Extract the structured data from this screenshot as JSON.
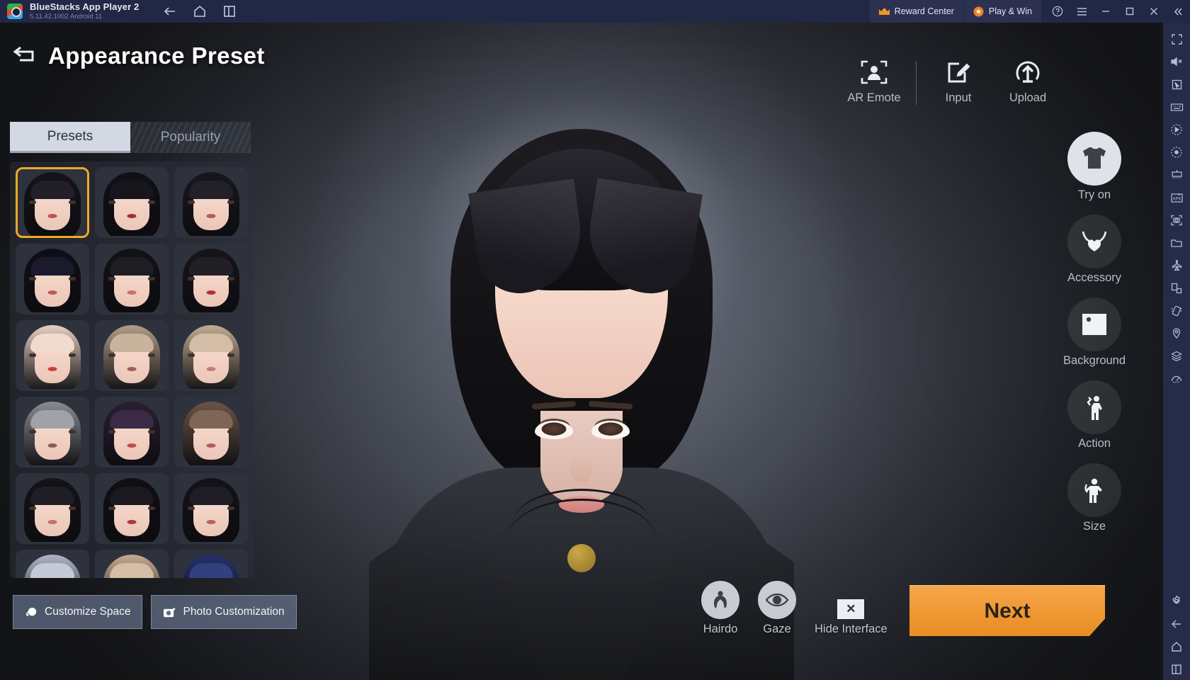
{
  "bluestacks": {
    "app_name": "BlueStacks App Player 2",
    "version_line": "5.11.42.1002  Android 11",
    "nav": [
      {
        "name": "back-icon",
        "label": "Back"
      },
      {
        "name": "home-icon",
        "label": "Home"
      },
      {
        "name": "multi-instance-icon",
        "label": "Multi-instance"
      }
    ],
    "reward_center": "Reward Center",
    "play_and_win": "Play & Win",
    "window_buttons": [
      {
        "name": "help-icon",
        "label": "Help"
      },
      {
        "name": "menu-icon",
        "label": "Menu"
      },
      {
        "name": "minimize-icon",
        "label": "Minimize"
      },
      {
        "name": "maximize-icon",
        "label": "Maximize"
      },
      {
        "name": "close-icon",
        "label": "Close"
      },
      {
        "name": "collapse-sidebar-icon",
        "label": "Collapse"
      }
    ],
    "sidebar_icons": [
      {
        "name": "fullscreen-icon",
        "label": "Full screen"
      },
      {
        "name": "mute-icon",
        "label": "Mute"
      },
      {
        "name": "cursor-icon",
        "label": "Game controls"
      },
      {
        "name": "keyboard-icon",
        "label": "Keymapping"
      },
      {
        "name": "macro-record-icon",
        "label": "Macro recorder"
      },
      {
        "name": "script-icon",
        "label": "Script"
      },
      {
        "name": "multi-instance-manager-icon",
        "label": "Multi-instance manager"
      },
      {
        "name": "install-apk-icon",
        "label": "Install APK"
      },
      {
        "name": "screenshot-icon",
        "label": "Screenshot"
      },
      {
        "name": "media-manager-icon",
        "label": "Media manager"
      },
      {
        "name": "airplane-icon",
        "label": "Airplane mode"
      },
      {
        "name": "rotate-screen-icon",
        "label": "Rotate"
      },
      {
        "name": "shake-icon",
        "label": "Shake"
      },
      {
        "name": "location-icon",
        "label": "Location"
      },
      {
        "name": "layers-icon",
        "label": "Eco mode"
      },
      {
        "name": "performance-icon",
        "label": "Performance"
      },
      {
        "name": "settings-gear-icon",
        "label": "Settings"
      },
      {
        "name": "android-back-icon",
        "label": "Back"
      },
      {
        "name": "android-home-icon",
        "label": "Home"
      },
      {
        "name": "android-recents-icon",
        "label": "Recents"
      }
    ]
  },
  "game": {
    "header": {
      "back_icon": "back-arrow-icon",
      "title": "Appearance Preset"
    },
    "tabs": [
      {
        "label": "Presets",
        "active": true
      },
      {
        "label": "Popularity",
        "active": false
      }
    ],
    "presets": [
      {
        "id": 1,
        "selected": true,
        "hair": "#14131a",
        "bang": "#221f28",
        "lip": "#c2544f",
        "label": "Preset 1"
      },
      {
        "id": 2,
        "selected": false,
        "hair": "#111016",
        "bang": "#17161d",
        "lip": "#9e2f36",
        "label": "Preset 2"
      },
      {
        "id": 3,
        "selected": false,
        "hair": "#18171d",
        "bang": "#232128",
        "lip": "#b85a55",
        "label": "Preset 3"
      },
      {
        "id": 4,
        "selected": false,
        "hair": "#0f0e18",
        "bang": "#1b1a2c",
        "lip": "#c45b56",
        "label": "Preset 4"
      },
      {
        "id": 5,
        "selected": false,
        "hair": "#131217",
        "bang": "#1f1d24",
        "lip": "#c9716b",
        "label": "Preset 5"
      },
      {
        "id": 6,
        "selected": false,
        "hair": "#16151a",
        "bang": "#222026",
        "lip": "#b42f33",
        "label": "Preset 6"
      },
      {
        "id": 7,
        "selected": false,
        "hair": "#e8cfc2",
        "bang": "#f0dbcf",
        "lip": "#d33c3c",
        "label": "Preset 7"
      },
      {
        "id": 8,
        "selected": false,
        "hair": "#b39d86",
        "bang": "#c8b49d",
        "lip": "#9c5d56",
        "label": "Preset 8"
      },
      {
        "id": 9,
        "selected": false,
        "hair": "#c2ab93",
        "bang": "#d3bda6",
        "lip": "#c08078",
        "label": "Preset 9"
      },
      {
        "id": 10,
        "selected": false,
        "hair": "#8a8c92",
        "bang": "#a0a2a8",
        "lip": "#8e5b55",
        "label": "Preset 10"
      },
      {
        "id": 11,
        "selected": false,
        "hair": "#2a1f33",
        "bang": "#3a2c45",
        "lip": "#b8504c",
        "label": "Preset 11"
      },
      {
        "id": 12,
        "selected": false,
        "hair": "#6b5446",
        "bang": "#7e6555",
        "lip": "#b05a59",
        "label": "Preset 12"
      },
      {
        "id": 13,
        "selected": false,
        "hair": "#141318",
        "bang": "#201e25",
        "lip": "#c4716c",
        "label": "Preset 13"
      },
      {
        "id": 14,
        "selected": false,
        "hair": "#100f14",
        "bang": "#1b191f",
        "lip": "#a83b3c",
        "label": "Preset 14"
      },
      {
        "id": 15,
        "selected": false,
        "hair": "#131219",
        "bang": "#1e1c25",
        "lip": "#b9615c",
        "label": "Preset 15"
      },
      {
        "id": 16,
        "selected": false,
        "hair": "#aeb4c4",
        "bang": "#c3c9d6",
        "lip": "#b06a66",
        "label": "Preset 16"
      },
      {
        "id": 17,
        "selected": false,
        "hair": "#c4a98f",
        "bang": "#d6bda4",
        "lip": "#b46a63",
        "label": "Preset 17"
      },
      {
        "id": 18,
        "selected": false,
        "hair": "#24306b",
        "bang": "#32407f",
        "lip": "#b4565a",
        "label": "Preset 18"
      }
    ],
    "bottom_left_buttons": [
      {
        "icon": "customize-space-icon",
        "label": "Customize Space"
      },
      {
        "icon": "photo-camera-icon",
        "label": "Photo Customization"
      }
    ],
    "top_right_tools": [
      {
        "icon": "ar-emote-icon",
        "label": "AR Emote"
      },
      {
        "icon": "input-edit-icon",
        "label": "Input"
      },
      {
        "icon": "upload-icon",
        "label": "Upload"
      }
    ],
    "right_menu": [
      {
        "icon": "tshirt-icon",
        "label": "Try on",
        "style": "light"
      },
      {
        "icon": "necklace-icon",
        "label": "Accessory",
        "style": "dark"
      },
      {
        "icon": "image-icon",
        "label": "Background",
        "style": "dark"
      },
      {
        "icon": "action-pose-icon",
        "label": "Action",
        "style": "dark"
      },
      {
        "icon": "body-size-icon",
        "label": "Size",
        "style": "dark"
      }
    ],
    "bottom_center_tools": [
      {
        "icon": "hairdo-icon",
        "label": "Hairdo"
      },
      {
        "icon": "eye-gaze-icon",
        "label": "Gaze"
      },
      {
        "icon": "hide-interface-icon",
        "label": "Hide Interface"
      }
    ],
    "next_button": "Next"
  },
  "colors": {
    "accent_orange": "#ef9733",
    "selected_border": "#f0a825",
    "titlebar_bg": "#222745",
    "sidebar_bg": "#262b4a"
  }
}
